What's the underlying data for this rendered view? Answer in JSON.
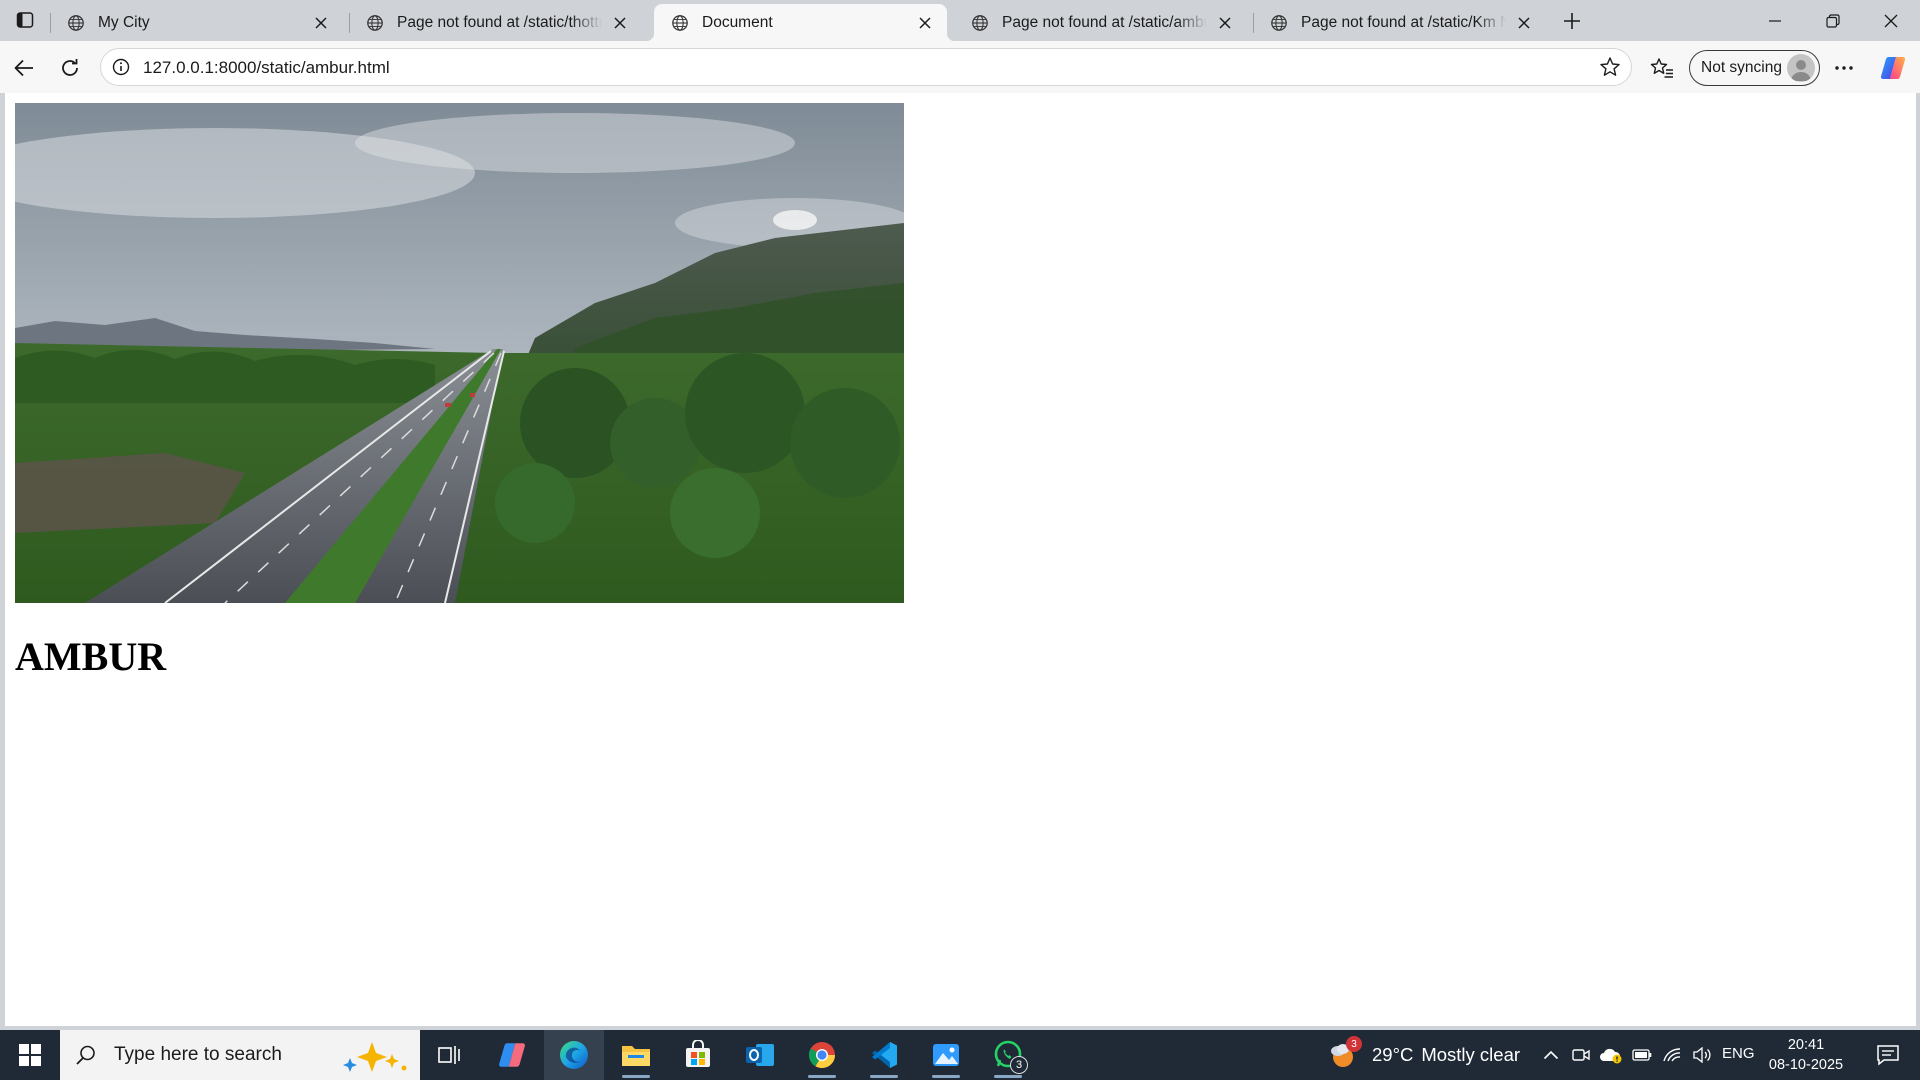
{
  "browser": {
    "tabs": [
      {
        "title": "My City",
        "active": false
      },
      {
        "title": "Page not found at /static/thottram",
        "active": false
      },
      {
        "title": "Document",
        "active": true
      },
      {
        "title": "Page not found at /static/ambur",
        "active": false
      },
      {
        "title": "Page not found at /static/Km Nu",
        "active": false
      }
    ],
    "address": {
      "url": "127.0.0.1:8000/static/ambur.html"
    },
    "profile_label": "Not syncing",
    "icons": {
      "tab_actions": "tab-actions-icon",
      "favicon": "globe-icon",
      "close": "close-icon",
      "new_tab": "plus-icon",
      "back": "back-arrow-icon",
      "reload": "reload-icon",
      "site_info": "info-icon",
      "favorite": "star-icon",
      "favorites": "favorites-icon",
      "more": "more-icon",
      "copilot": "copilot-icon"
    }
  },
  "page": {
    "heading": "AMBUR",
    "hero_image": "highway through green valley with hills under cloudy sky"
  },
  "taskbar": {
    "search_placeholder": "Type here to search",
    "apps": [
      {
        "name": "Copilot",
        "icon": "copilot-icon"
      },
      {
        "name": "Microsoft Edge",
        "icon": "edge-icon",
        "active": true
      },
      {
        "name": "File Explorer",
        "icon": "folder-icon",
        "running": true
      },
      {
        "name": "Microsoft Store",
        "icon": "store-icon"
      },
      {
        "name": "Outlook",
        "icon": "outlook-icon"
      },
      {
        "name": "Google Chrome",
        "icon": "chrome-icon",
        "running": true
      },
      {
        "name": "Visual Studio Code",
        "icon": "vscode-icon",
        "running": true
      },
      {
        "name": "Photos",
        "icon": "photos-icon",
        "running": true
      },
      {
        "name": "WhatsApp",
        "icon": "whatsapp-icon",
        "running": true,
        "badge": "3"
      }
    ],
    "weather": {
      "badge": "3",
      "temperature": "29°C",
      "condition": "Mostly clear"
    },
    "language": "ENG",
    "time": "20:41",
    "date": "08-10-2025"
  },
  "colors": {
    "tabstrip": "#cfd3d8",
    "toolbar": "#f7f7f7",
    "taskbar": "#1f2a36",
    "accent": "#0078d4"
  }
}
